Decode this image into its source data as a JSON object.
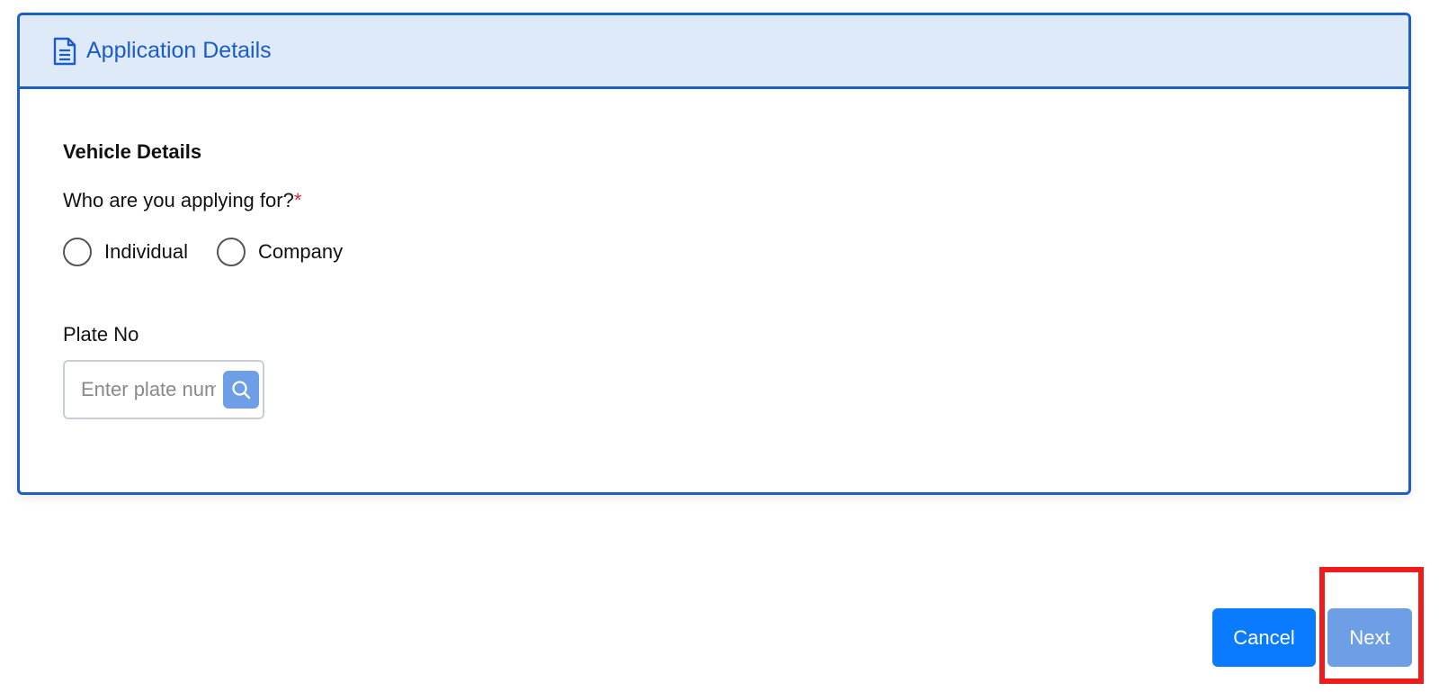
{
  "header": {
    "title": "Application Details",
    "icon": "document-icon"
  },
  "form": {
    "section_title": "Vehicle Details",
    "question": "Who are you applying for?",
    "required_mark": "*",
    "options": [
      {
        "label": "Individual",
        "selected": false
      },
      {
        "label": "Company",
        "selected": false
      }
    ],
    "plate_label": "Plate No",
    "plate_placeholder": "Enter plate number",
    "plate_value": ""
  },
  "actions": {
    "cancel_label": "Cancel",
    "next_label": "Next"
  },
  "colors": {
    "primary": "#0a7bff",
    "disabled_primary": "#6d9ee6",
    "header_bg": "#deeaf7",
    "border_accent": "#1f5fc4",
    "required": "#e0263f",
    "highlight": "#ee1c1c"
  }
}
